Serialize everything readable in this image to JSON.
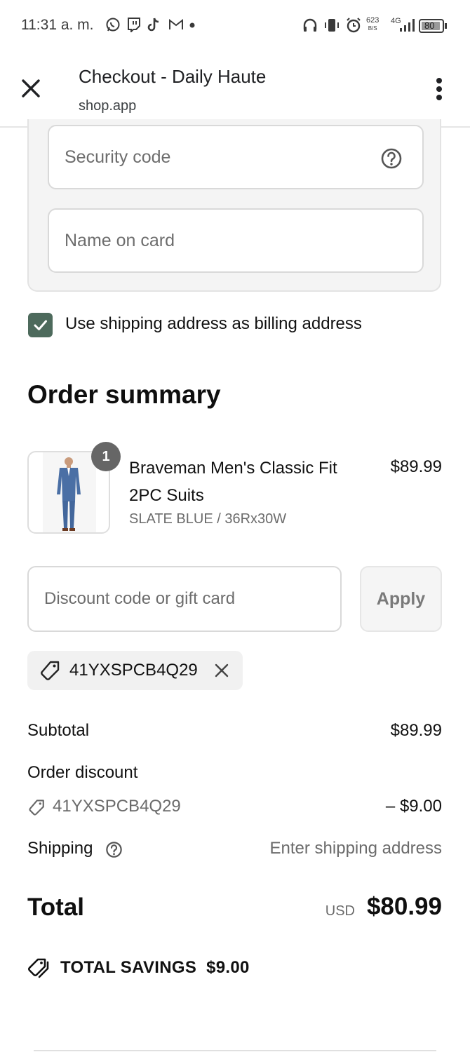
{
  "status_bar": {
    "time": "11:31 a. m.",
    "net_speed_top": "623",
    "net_speed_bottom": "B/S",
    "network": "4G",
    "battery": "80"
  },
  "browser": {
    "title": "Checkout - Daily Haute",
    "url": "shop.app"
  },
  "payment": {
    "security_code_placeholder": "Security code",
    "name_on_card_placeholder": "Name on card"
  },
  "billing": {
    "checked": true,
    "label": "Use shipping address as billing address"
  },
  "order_summary": {
    "heading": "Order summary",
    "item": {
      "quantity": "1",
      "name": "Braveman Men's Classic Fit 2PC Suits",
      "variant": "SLATE BLUE / 36Rx30W",
      "price": "$89.99"
    },
    "discount_placeholder": "Discount code or gift card",
    "apply_label": "Apply",
    "applied_code": "41YXSPCB4Q29"
  },
  "totals": {
    "subtotal_label": "Subtotal",
    "subtotal_value": "$89.99",
    "discount_label": "Order discount",
    "discount_code": "41YXSPCB4Q29",
    "discount_value": "– $9.00",
    "shipping_label": "Shipping",
    "shipping_value": "Enter shipping address",
    "total_label": "Total",
    "currency": "USD",
    "total_value": "$80.99",
    "savings_label": "TOTAL SAVINGS",
    "savings_value": "$9.00"
  },
  "colors": {
    "checkbox": "#4d6a5c",
    "qty_badge": "#666666"
  }
}
